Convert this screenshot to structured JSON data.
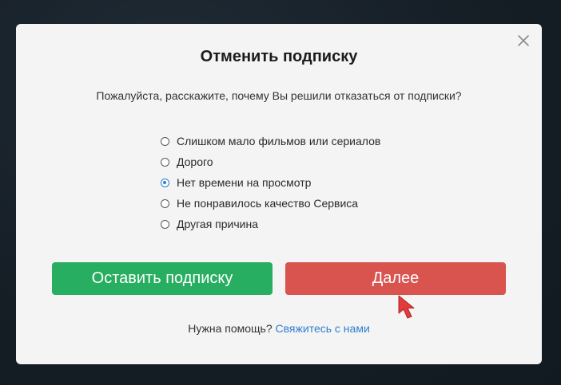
{
  "dialog": {
    "title": "Отменить подписку",
    "subtitle": "Пожалуйста, расскажите, почему Вы решили отказаться от подписки?",
    "close_icon": "close-icon",
    "reasons": [
      {
        "label": "Слишком мало фильмов или сериалов",
        "checked": false
      },
      {
        "label": "Дорого",
        "checked": false
      },
      {
        "label": "Нет времени на просмотр",
        "checked": true
      },
      {
        "label": "Не понравилось качество Сервиса",
        "checked": false
      },
      {
        "label": "Другая причина",
        "checked": false
      }
    ],
    "keep_button": "Оставить подписку",
    "next_button": "Далее",
    "help_text": "Нужна помощь?",
    "help_link": "Свяжитесь с нами"
  },
  "colors": {
    "accent_green": "#27ae60",
    "accent_red": "#d9534f",
    "link_blue": "#2f7fd0",
    "cursor": "#e23b3b"
  }
}
